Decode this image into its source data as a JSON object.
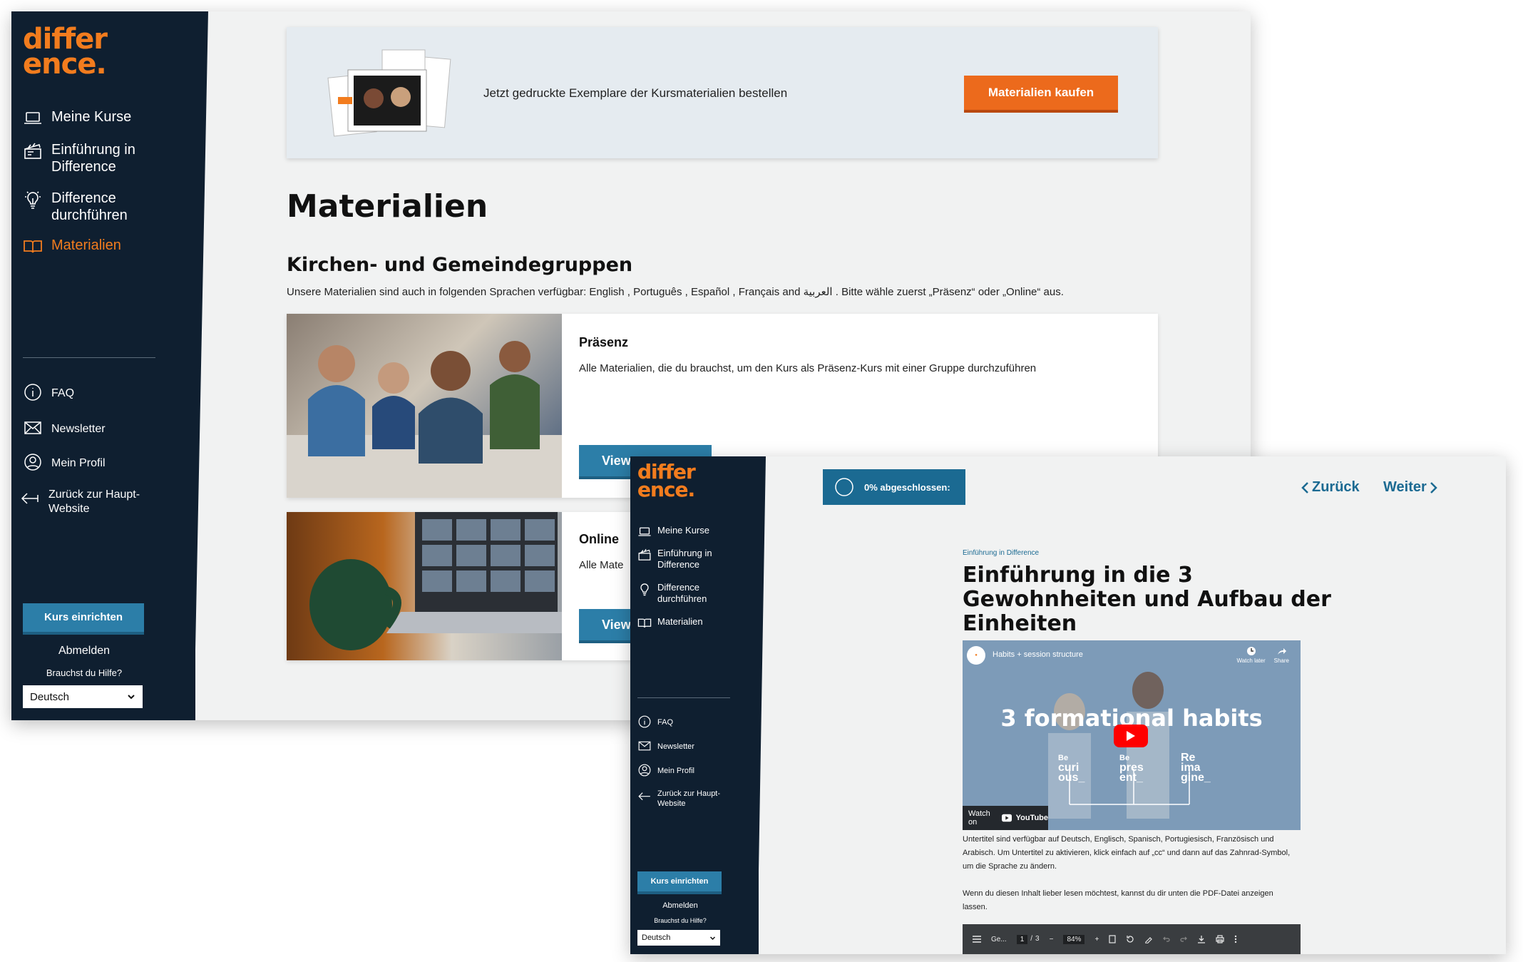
{
  "screen1": {
    "logo": {
      "line1": "differ",
      "line2": "ence."
    },
    "nav": {
      "meine_kurse": "Meine Kurse",
      "einfuehrung": [
        "Einführung in",
        "Difference"
      ],
      "durchfuehren": [
        "Difference",
        "durchführen"
      ],
      "materialien": "Materialien"
    },
    "secondary_nav": {
      "faq": "FAQ",
      "newsletter": "Newsletter",
      "profil": "Mein Profil",
      "zurueck": [
        "Zurück zur Haupt-",
        "Website"
      ]
    },
    "kurs_button": "Kurs einrichten",
    "abmelden": "Abmelden",
    "hilfe": "Brauchst du Hilfe?",
    "language": "Deutsch",
    "banner": {
      "text": "Jetzt gedruckte Exemplare der Kursmaterialien bestellen",
      "button": "Materialien kaufen"
    },
    "page_title": "Materialien",
    "section_title": "Kirchen- und Gemeindegruppen",
    "languages_text": "Unsere Materialien sind auch in folgenden Sprachen verfügbar: English , Português , Español , Français and العربية . Bitte wähle zuerst „Präsenz“ oder „Online“ aus.",
    "cards": [
      {
        "title": "Präsenz",
        "desc": "Alle Materialien, die du brauchst, um den Kurs als Präsenz-Kurs mit einer Gruppe durchzuführen",
        "button": "View"
      },
      {
        "title": "Online",
        "desc": "Alle Mate",
        "button": "View"
      }
    ]
  },
  "screen2": {
    "logo": {
      "line1": "differ",
      "line2": "ence."
    },
    "nav": {
      "meine_kurse": "Meine Kurse",
      "einfuehrung": [
        "Einführung in",
        "Difference"
      ],
      "durchfuehren": [
        "Difference",
        "durchführen"
      ],
      "materialien": "Materialien"
    },
    "secondary_nav": {
      "faq": "FAQ",
      "newsletter": "Newsletter",
      "profil": "Mein Profil",
      "zurueck": [
        "Zurück zur Haupt-",
        "Website"
      ]
    },
    "kurs_button": "Kurs einrichten",
    "abmelden": "Abmelden",
    "hilfe": "Brauchst du Hilfe?",
    "language": "Deutsch",
    "progress": "0% abgeschlossen:",
    "progress_fraction": 0,
    "back": "Zurück",
    "next": "Weiter",
    "breadcrumb": "Einführung in Difference",
    "title": [
      "Einführung in die 3",
      "Gewohnheiten und Aufbau der",
      "Einheiten"
    ],
    "video": {
      "channel_title": "Habits + session structure",
      "watch_later": "Watch later",
      "share": "Share",
      "headline": "3 formational habits",
      "words": [
        [
          "Be",
          "curi",
          "ous_"
        ],
        [
          "Be",
          "pres",
          "ent_"
        ],
        [
          "Re",
          "ima",
          "gine_"
        ]
      ],
      "watch_on": "Watch on",
      "youtube": "YouTube"
    },
    "subtitle_text": "Untertitel sind verfügbar auf Deutsch, Englisch, Spanisch, Portugiesisch, Französisch und Arabisch. Um Untertitel zu aktivieren, klick einfach auf „cc“ und dann auf das Zahnrad-Symbol, um die Sprache zu ändern.",
    "pdf_text": "Wenn du diesen Inhalt lieber lesen möchtest, kannst du dir unten die PDF-Datei anzeigen lassen.",
    "pdf_toolbar": {
      "doc": "Ge...",
      "page": "1",
      "pages": "3",
      "zoom": "84%"
    }
  }
}
